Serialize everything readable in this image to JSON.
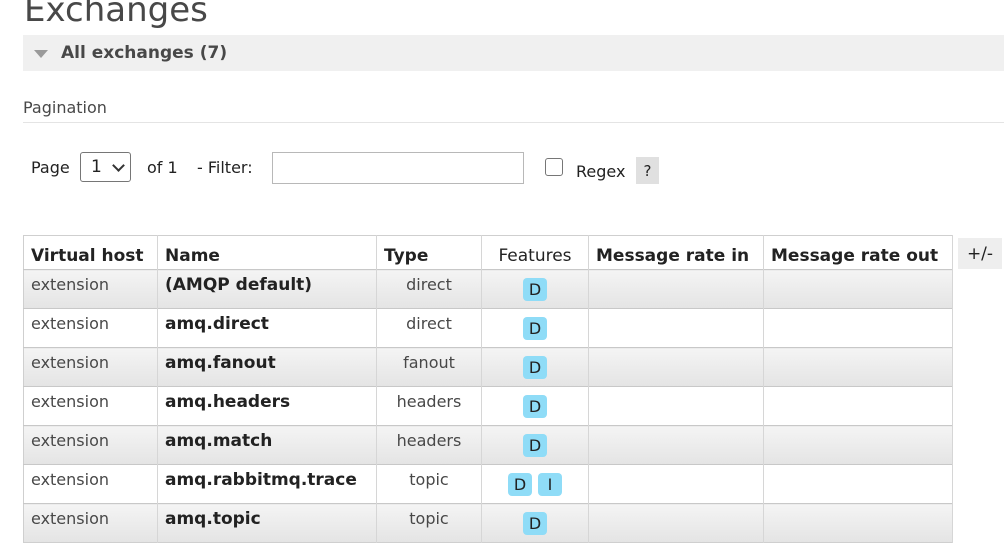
{
  "page_title": "Exchanges",
  "section": {
    "label": "All exchanges (7)"
  },
  "pagination": {
    "label": "Pagination",
    "page_label": "Page",
    "page_value": "1",
    "of_label": "of 1",
    "filter_label": "- Filter:",
    "filter_value": "",
    "regex_label": "Regex",
    "help_label": "?"
  },
  "table": {
    "columns": {
      "vhost": "Virtual host",
      "name": "Name",
      "type": "Type",
      "features": "Features",
      "rate_in": "Message rate in",
      "rate_out": "Message rate out"
    },
    "toggle_columns_label": "+/-",
    "rows": [
      {
        "vhost": "extension",
        "name": "(AMQP default)",
        "type": "direct",
        "features": [
          "D"
        ],
        "rate_in": "",
        "rate_out": ""
      },
      {
        "vhost": "extension",
        "name": "amq.direct",
        "type": "direct",
        "features": [
          "D"
        ],
        "rate_in": "",
        "rate_out": ""
      },
      {
        "vhost": "extension",
        "name": "amq.fanout",
        "type": "fanout",
        "features": [
          "D"
        ],
        "rate_in": "",
        "rate_out": ""
      },
      {
        "vhost": "extension",
        "name": "amq.headers",
        "type": "headers",
        "features": [
          "D"
        ],
        "rate_in": "",
        "rate_out": ""
      },
      {
        "vhost": "extension",
        "name": "amq.match",
        "type": "headers",
        "features": [
          "D"
        ],
        "rate_in": "",
        "rate_out": ""
      },
      {
        "vhost": "extension",
        "name": "amq.rabbitmq.trace",
        "type": "topic",
        "features": [
          "D",
          "I"
        ],
        "rate_in": "",
        "rate_out": ""
      },
      {
        "vhost": "extension",
        "name": "amq.topic",
        "type": "topic",
        "features": [
          "D"
        ],
        "rate_in": "",
        "rate_out": ""
      }
    ]
  },
  "colors": {
    "badge": "#8fdcf7",
    "header_bar": "#f0f0f0",
    "text": "#484848"
  }
}
